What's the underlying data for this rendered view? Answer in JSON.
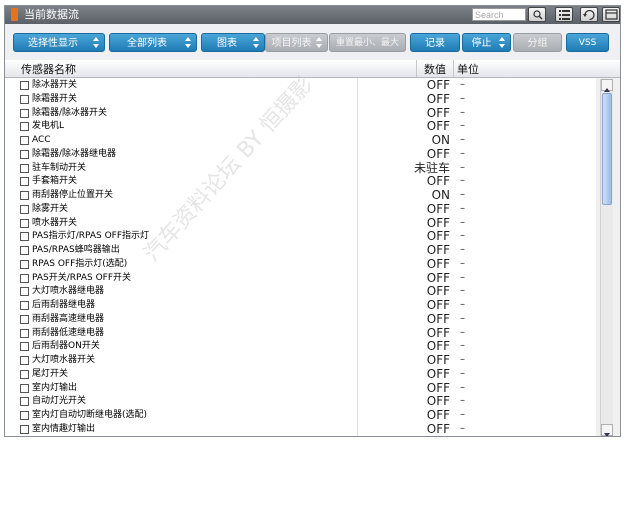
{
  "window": {
    "title": "当前数据流"
  },
  "search": {
    "placeholder": "Search"
  },
  "toolbar": {
    "select_display": "选择性显示",
    "full_list": "全部列表",
    "chart": "图表",
    "item_list": "项目列表",
    "reset_minmax": "重置最小、最大",
    "record": "记录",
    "stop": "停止",
    "group": "分组",
    "vss": "VSS"
  },
  "columns": {
    "name": "传感器名称",
    "value": "数值",
    "unit": "单位"
  },
  "rows": [
    {
      "name": "除冰器开关",
      "value": "OFF",
      "unit": "–"
    },
    {
      "name": "除霜器开关",
      "value": "OFF",
      "unit": "–"
    },
    {
      "name": "除霜器/除冰器开关",
      "value": "OFF",
      "unit": "–"
    },
    {
      "name": "发电机L",
      "value": "OFF",
      "unit": "–"
    },
    {
      "name": "ACC",
      "value": "ON",
      "unit": "–"
    },
    {
      "name": "除霜器/除冰器继电器",
      "value": "OFF",
      "unit": "–"
    },
    {
      "name": "驻车制动开关",
      "value": "未驻车",
      "unit": "–"
    },
    {
      "name": "手套箱开关",
      "value": "OFF",
      "unit": "–"
    },
    {
      "name": "雨刮器停止位置开关",
      "value": "ON",
      "unit": "–"
    },
    {
      "name": "除雾开关",
      "value": "OFF",
      "unit": "–"
    },
    {
      "name": "喷水器开关",
      "value": "OFF",
      "unit": "–"
    },
    {
      "name": "PAS指示灯/RPAS OFF指示灯",
      "value": "OFF",
      "unit": "–"
    },
    {
      "name": "PAS/RPAS蜂鸣器输出",
      "value": "OFF",
      "unit": "–"
    },
    {
      "name": "RPAS OFF指示灯(选配)",
      "value": "OFF",
      "unit": "–"
    },
    {
      "name": "PAS开关/RPAS OFF开关",
      "value": "OFF",
      "unit": "–"
    },
    {
      "name": "大灯喷水器继电器",
      "value": "OFF",
      "unit": "–"
    },
    {
      "name": "后雨刮器继电器",
      "value": "OFF",
      "unit": "–"
    },
    {
      "name": "雨刮器高速继电器",
      "value": "OFF",
      "unit": "–"
    },
    {
      "name": "雨刮器低速继电器",
      "value": "OFF",
      "unit": "–"
    },
    {
      "name": "后雨刮器ON开关",
      "value": "OFF",
      "unit": "–"
    },
    {
      "name": "大灯喷水器开关",
      "value": "OFF",
      "unit": "–"
    },
    {
      "name": "尾灯开关",
      "value": "OFF",
      "unit": "–"
    },
    {
      "name": "室内灯输出",
      "value": "OFF",
      "unit": "–"
    },
    {
      "name": "自动灯光开关",
      "value": "OFF",
      "unit": "–"
    },
    {
      "name": "室内灯自动切断继电器(选配)",
      "value": "OFF",
      "unit": "–"
    },
    {
      "name": "室内情趣灯输出",
      "value": "OFF",
      "unit": "–"
    }
  ],
  "watermark": "汽车资料论坛 BY 恒摄影"
}
